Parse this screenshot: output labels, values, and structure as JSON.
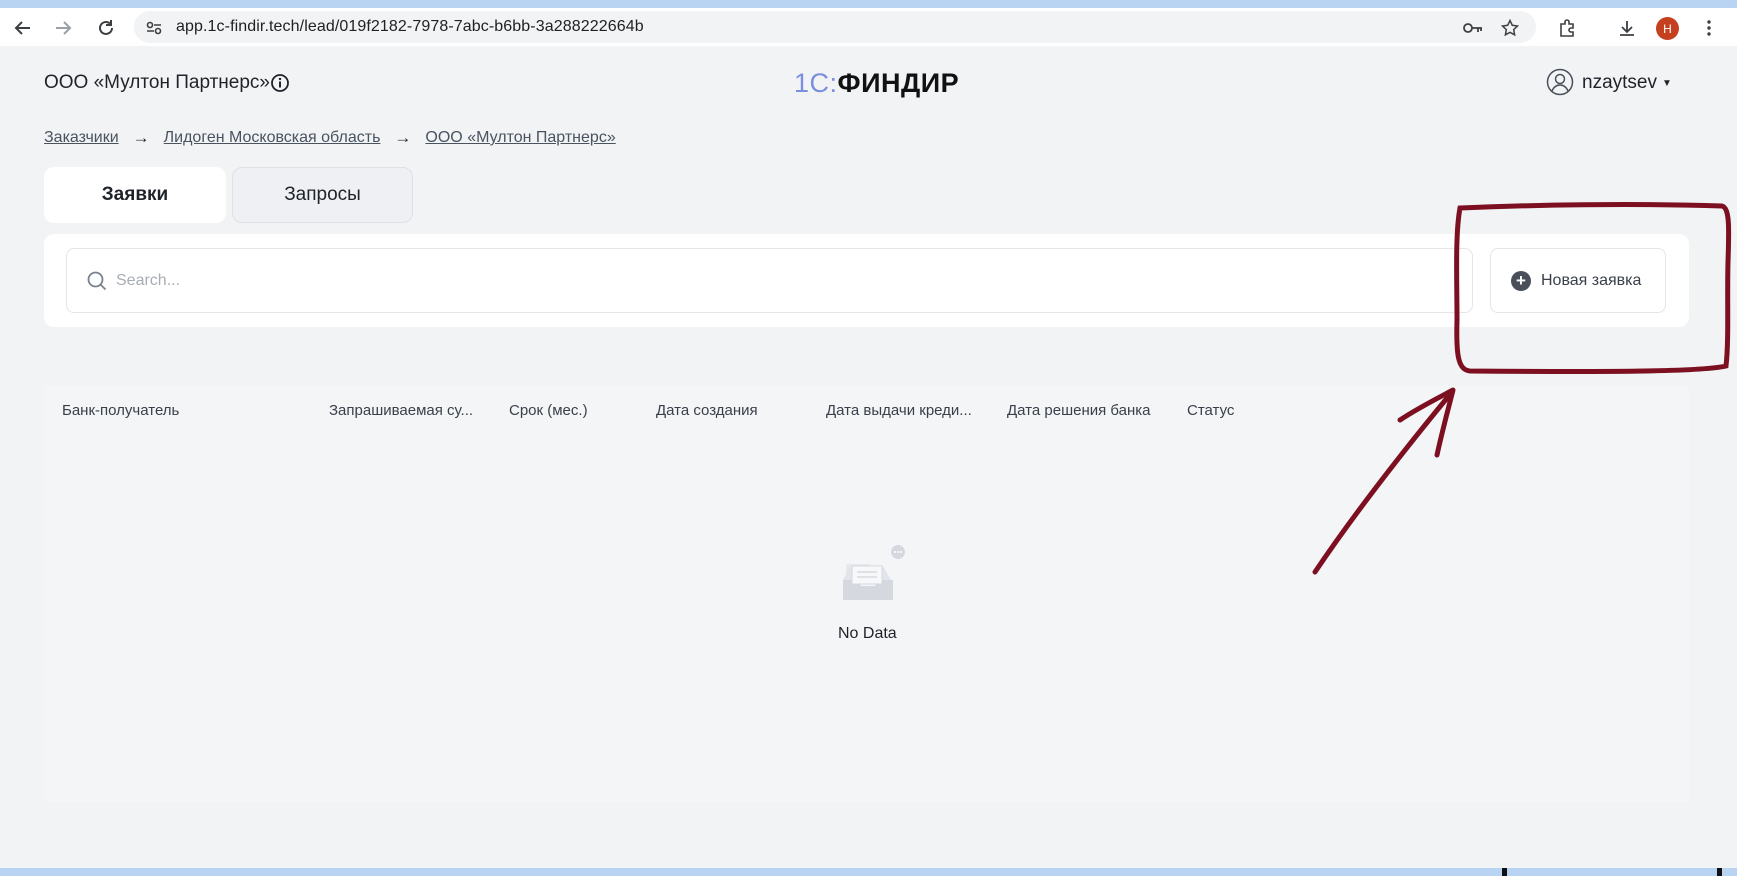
{
  "browser": {
    "url": "app.1c-findir.tech/lead/019f2182-7978-7abc-b6bb-3a288222664b",
    "profile_initial": "Н"
  },
  "header": {
    "company": "ООО «Мултон Партнерс»",
    "logo_prefix": "1С:",
    "logo_name": "ФИНДИР",
    "username": "nzaytsev"
  },
  "breadcrumb": {
    "items": [
      "Заказчики",
      "Лидоген Московская область",
      "ООО «Мултон Партнерс»"
    ],
    "separator": "→"
  },
  "tabs": [
    {
      "label": "Заявки",
      "active": true
    },
    {
      "label": "Запросы",
      "active": false
    }
  ],
  "search": {
    "placeholder": "Search..."
  },
  "new_request_button": {
    "label": "Новая заявка"
  },
  "table": {
    "columns": [
      "Банк-получатель",
      "Запрашиваемая су...",
      "Срок (мес.)",
      "Дата создания",
      "Дата выдачи креди...",
      "Дата решения банка",
      "Статус"
    ],
    "empty_text": "No Data"
  },
  "annotation": {
    "color": "#7d1020"
  }
}
